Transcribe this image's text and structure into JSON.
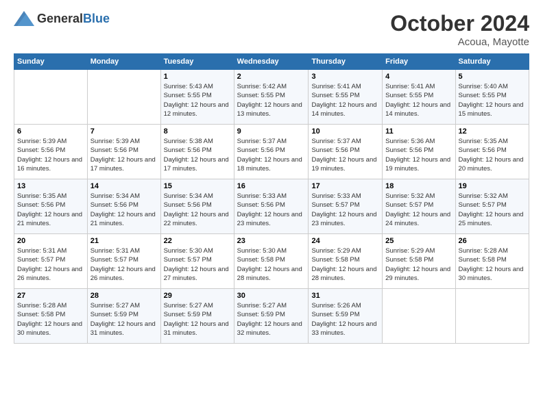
{
  "header": {
    "logo_general": "General",
    "logo_blue": "Blue",
    "month_year": "October 2024",
    "location": "Acoua, Mayotte"
  },
  "calendar": {
    "weekdays": [
      "Sunday",
      "Monday",
      "Tuesday",
      "Wednesday",
      "Thursday",
      "Friday",
      "Saturday"
    ],
    "weeks": [
      [
        {
          "day": "",
          "sunrise": "",
          "sunset": "",
          "daylight": ""
        },
        {
          "day": "",
          "sunrise": "",
          "sunset": "",
          "daylight": ""
        },
        {
          "day": "1",
          "sunrise": "Sunrise: 5:43 AM",
          "sunset": "Sunset: 5:55 PM",
          "daylight": "Daylight: 12 hours and 12 minutes."
        },
        {
          "day": "2",
          "sunrise": "Sunrise: 5:42 AM",
          "sunset": "Sunset: 5:55 PM",
          "daylight": "Daylight: 12 hours and 13 minutes."
        },
        {
          "day": "3",
          "sunrise": "Sunrise: 5:41 AM",
          "sunset": "Sunset: 5:55 PM",
          "daylight": "Daylight: 12 hours and 14 minutes."
        },
        {
          "day": "4",
          "sunrise": "Sunrise: 5:41 AM",
          "sunset": "Sunset: 5:55 PM",
          "daylight": "Daylight: 12 hours and 14 minutes."
        },
        {
          "day": "5",
          "sunrise": "Sunrise: 5:40 AM",
          "sunset": "Sunset: 5:55 PM",
          "daylight": "Daylight: 12 hours and 15 minutes."
        }
      ],
      [
        {
          "day": "6",
          "sunrise": "Sunrise: 5:39 AM",
          "sunset": "Sunset: 5:56 PM",
          "daylight": "Daylight: 12 hours and 16 minutes."
        },
        {
          "day": "7",
          "sunrise": "Sunrise: 5:39 AM",
          "sunset": "Sunset: 5:56 PM",
          "daylight": "Daylight: 12 hours and 17 minutes."
        },
        {
          "day": "8",
          "sunrise": "Sunrise: 5:38 AM",
          "sunset": "Sunset: 5:56 PM",
          "daylight": "Daylight: 12 hours and 17 minutes."
        },
        {
          "day": "9",
          "sunrise": "Sunrise: 5:37 AM",
          "sunset": "Sunset: 5:56 PM",
          "daylight": "Daylight: 12 hours and 18 minutes."
        },
        {
          "day": "10",
          "sunrise": "Sunrise: 5:37 AM",
          "sunset": "Sunset: 5:56 PM",
          "daylight": "Daylight: 12 hours and 19 minutes."
        },
        {
          "day": "11",
          "sunrise": "Sunrise: 5:36 AM",
          "sunset": "Sunset: 5:56 PM",
          "daylight": "Daylight: 12 hours and 19 minutes."
        },
        {
          "day": "12",
          "sunrise": "Sunrise: 5:35 AM",
          "sunset": "Sunset: 5:56 PM",
          "daylight": "Daylight: 12 hours and 20 minutes."
        }
      ],
      [
        {
          "day": "13",
          "sunrise": "Sunrise: 5:35 AM",
          "sunset": "Sunset: 5:56 PM",
          "daylight": "Daylight: 12 hours and 21 minutes."
        },
        {
          "day": "14",
          "sunrise": "Sunrise: 5:34 AM",
          "sunset": "Sunset: 5:56 PM",
          "daylight": "Daylight: 12 hours and 21 minutes."
        },
        {
          "day": "15",
          "sunrise": "Sunrise: 5:34 AM",
          "sunset": "Sunset: 5:56 PM",
          "daylight": "Daylight: 12 hours and 22 minutes."
        },
        {
          "day": "16",
          "sunrise": "Sunrise: 5:33 AM",
          "sunset": "Sunset: 5:56 PM",
          "daylight": "Daylight: 12 hours and 23 minutes."
        },
        {
          "day": "17",
          "sunrise": "Sunrise: 5:33 AM",
          "sunset": "Sunset: 5:57 PM",
          "daylight": "Daylight: 12 hours and 23 minutes."
        },
        {
          "day": "18",
          "sunrise": "Sunrise: 5:32 AM",
          "sunset": "Sunset: 5:57 PM",
          "daylight": "Daylight: 12 hours and 24 minutes."
        },
        {
          "day": "19",
          "sunrise": "Sunrise: 5:32 AM",
          "sunset": "Sunset: 5:57 PM",
          "daylight": "Daylight: 12 hours and 25 minutes."
        }
      ],
      [
        {
          "day": "20",
          "sunrise": "Sunrise: 5:31 AM",
          "sunset": "Sunset: 5:57 PM",
          "daylight": "Daylight: 12 hours and 26 minutes."
        },
        {
          "day": "21",
          "sunrise": "Sunrise: 5:31 AM",
          "sunset": "Sunset: 5:57 PM",
          "daylight": "Daylight: 12 hours and 26 minutes."
        },
        {
          "day": "22",
          "sunrise": "Sunrise: 5:30 AM",
          "sunset": "Sunset: 5:57 PM",
          "daylight": "Daylight: 12 hours and 27 minutes."
        },
        {
          "day": "23",
          "sunrise": "Sunrise: 5:30 AM",
          "sunset": "Sunset: 5:58 PM",
          "daylight": "Daylight: 12 hours and 28 minutes."
        },
        {
          "day": "24",
          "sunrise": "Sunrise: 5:29 AM",
          "sunset": "Sunset: 5:58 PM",
          "daylight": "Daylight: 12 hours and 28 minutes."
        },
        {
          "day": "25",
          "sunrise": "Sunrise: 5:29 AM",
          "sunset": "Sunset: 5:58 PM",
          "daylight": "Daylight: 12 hours and 29 minutes."
        },
        {
          "day": "26",
          "sunrise": "Sunrise: 5:28 AM",
          "sunset": "Sunset: 5:58 PM",
          "daylight": "Daylight: 12 hours and 30 minutes."
        }
      ],
      [
        {
          "day": "27",
          "sunrise": "Sunrise: 5:28 AM",
          "sunset": "Sunset: 5:58 PM",
          "daylight": "Daylight: 12 hours and 30 minutes."
        },
        {
          "day": "28",
          "sunrise": "Sunrise: 5:27 AM",
          "sunset": "Sunset: 5:59 PM",
          "daylight": "Daylight: 12 hours and 31 minutes."
        },
        {
          "day": "29",
          "sunrise": "Sunrise: 5:27 AM",
          "sunset": "Sunset: 5:59 PM",
          "daylight": "Daylight: 12 hours and 31 minutes."
        },
        {
          "day": "30",
          "sunrise": "Sunrise: 5:27 AM",
          "sunset": "Sunset: 5:59 PM",
          "daylight": "Daylight: 12 hours and 32 minutes."
        },
        {
          "day": "31",
          "sunrise": "Sunrise: 5:26 AM",
          "sunset": "Sunset: 5:59 PM",
          "daylight": "Daylight: 12 hours and 33 minutes."
        },
        {
          "day": "",
          "sunrise": "",
          "sunset": "",
          "daylight": ""
        },
        {
          "day": "",
          "sunrise": "",
          "sunset": "",
          "daylight": ""
        }
      ]
    ]
  }
}
